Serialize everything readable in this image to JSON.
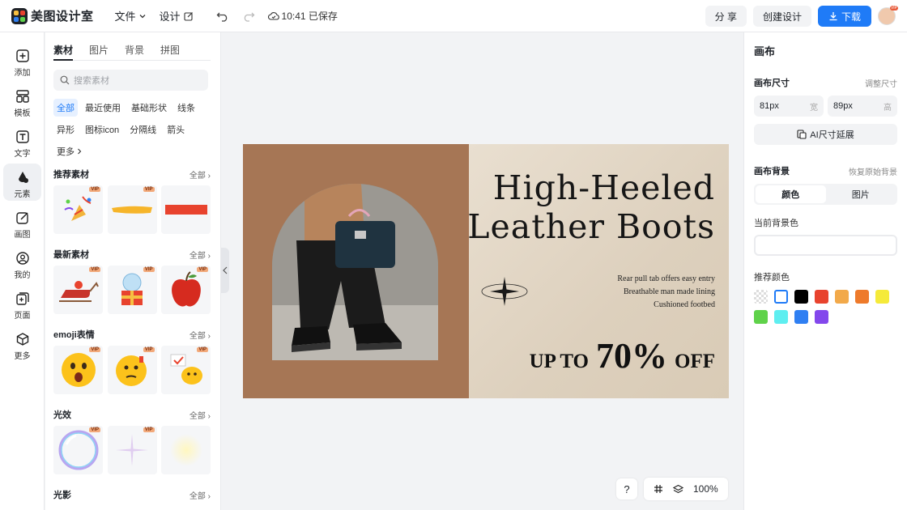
{
  "app": {
    "logo_text": "美图设计室"
  },
  "topbar": {
    "file_label": "文件",
    "design_label": "设计",
    "save_status": "10:41 已保存",
    "share_label": "分 享",
    "create_label": "创建设计",
    "download_label": "下载",
    "avatar_badge": "VIP"
  },
  "rail": {
    "items": [
      {
        "label": "添加",
        "icon": "plus-square-icon"
      },
      {
        "label": "模板",
        "icon": "template-icon"
      },
      {
        "label": "文字",
        "icon": "text-icon"
      },
      {
        "label": "元素",
        "icon": "elements-icon"
      },
      {
        "label": "画图",
        "icon": "draw-icon"
      },
      {
        "label": "我的",
        "icon": "user-icon"
      },
      {
        "label": "页面",
        "icon": "page-icon"
      },
      {
        "label": "更多",
        "icon": "more-cube-icon"
      }
    ]
  },
  "panel": {
    "tabs": [
      "素材",
      "图片",
      "背景",
      "拼图"
    ],
    "search_placeholder": "搜索素材",
    "chips": [
      "全部",
      "最近使用",
      "基础形状",
      "线条",
      "异形",
      "图标icon",
      "分隔线",
      "箭头",
      "更多"
    ],
    "sections": [
      {
        "title": "推荐素材",
        "all": "全部"
      },
      {
        "title": "最新素材",
        "all": "全部"
      },
      {
        "title": "emoji表情",
        "all": "全部"
      },
      {
        "title": "光效",
        "all": "全部"
      },
      {
        "title": "光影",
        "all": "全部"
      }
    ],
    "vip_badge": "VIP"
  },
  "canvas": {
    "headline_line1": "High-Heeled",
    "headline_line2": "Leather Boots",
    "feature_1": "Rear pull tab offers easy entry",
    "feature_2": "Breathable man made lining",
    "feature_3": "Cushioned footbed",
    "promo_prefix": "UP TO",
    "promo_value": "70%",
    "promo_suffix": "OFF"
  },
  "zoom": {
    "help": "?",
    "level": "100%"
  },
  "right_panel": {
    "title": "画布",
    "size_label": "画布尺寸",
    "adjust_label": "调整尺寸",
    "width_value": "81px",
    "width_unit": "宽",
    "height_value": "89px",
    "height_unit": "高",
    "ai_extend_label": "AI尺寸延展",
    "bg_label": "画布背景",
    "restore_label": "恢复原始背景",
    "seg_color": "颜色",
    "seg_image": "图片",
    "current_bg_label": "当前背景色",
    "recommend_label": "推荐颜色",
    "swatches": [
      "transparent",
      "#ffffff",
      "#000000",
      "#e8432e",
      "#f2a94a",
      "#ee7a2b",
      "#f5ea3a",
      "#5fd24a",
      "#5eeef0",
      "#2f7ff2",
      "#8347ec"
    ]
  }
}
